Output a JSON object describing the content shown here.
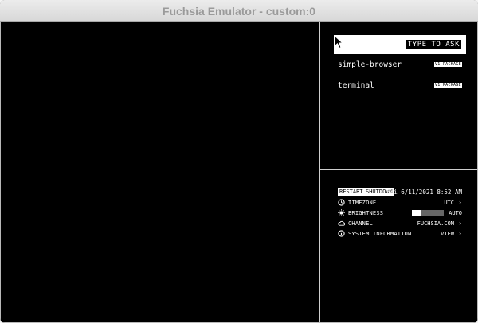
{
  "window": {
    "title": "Fuchsia Emulator - custom:0"
  },
  "ask": {
    "placeholder": "TYPE TO ASK"
  },
  "suggestions": [
    {
      "name": "simple-browser",
      "tag": "V1 PACKAGE"
    },
    {
      "name": "terminal",
      "tag": "V1 PACKAGE"
    }
  ],
  "quick_settings": {
    "restart_label": "RESTART",
    "shutdown_label": "SHUTDOWN",
    "datetime": "Fri 6/11/2021 8:52 AM",
    "items": [
      {
        "icon": "clock-icon",
        "label": "TIMEZONE",
        "value": "UTC"
      },
      {
        "icon": "brightness-icon",
        "label": "BRIGHTNESS",
        "value": "AUTO",
        "level": 0.3
      },
      {
        "icon": "cloud-icon",
        "label": "CHANNEL",
        "value": "FUCHSIA.COM"
      },
      {
        "icon": "info-icon",
        "label": "SYSTEM INFORMATION",
        "value": "VIEW"
      }
    ]
  },
  "colors": {
    "background": "#000000",
    "foreground": "#ffffff",
    "divider": "#cfcfcf"
  }
}
